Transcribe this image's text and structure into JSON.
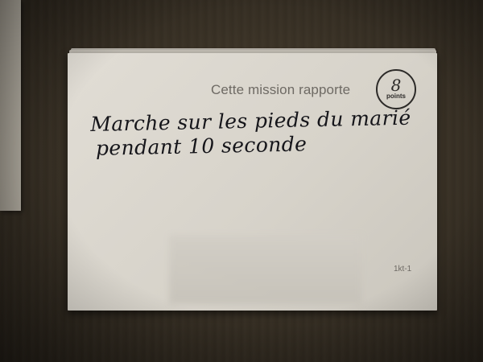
{
  "card": {
    "printed_text": "Cette mission rapporte",
    "points": {
      "number": "8",
      "label": "points"
    },
    "handwritten_text": {
      "line1": "Marche sur les pieds du marié",
      "line2": "pendant 10 seconde"
    },
    "code": "1kt-1"
  }
}
